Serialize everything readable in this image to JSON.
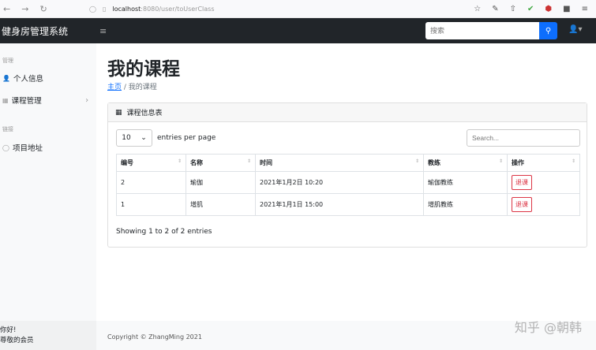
{
  "browser": {
    "url_host": "localhost",
    "url_path": ":8080/user/toUserClass"
  },
  "header": {
    "brand": "健身房管理系统",
    "search_placeholder": "搜索"
  },
  "sidebar": {
    "section1": "管理",
    "items": [
      {
        "label": "个人信息"
      },
      {
        "label": "课程管理"
      }
    ],
    "section2": "链接",
    "link": "项目地址",
    "greeting": "你好!",
    "role": "尊敬的会员"
  },
  "main": {
    "title": "我的课程",
    "breadcrumb_home": "主页",
    "breadcrumb_current": "我的课程",
    "card_title": "课程信息表",
    "page_size": "10",
    "entries_label": "entries per page",
    "search_placeholder": "Search...",
    "columns": [
      "编号",
      "名称",
      "时间",
      "教练",
      "操作"
    ],
    "rows": [
      {
        "id": "2",
        "name": "瑜伽",
        "time": "2021年1月2日 10:20",
        "coach": "瑜伽教练",
        "action": "退课"
      },
      {
        "id": "1",
        "name": "增肌",
        "time": "2021年1月1日 15:00",
        "coach": "增肌教练",
        "action": "退课"
      }
    ],
    "info": "Showing 1 to 2 of 2 entries"
  },
  "footer": {
    "copyright": "Copyright © ZhangMing 2021"
  },
  "watermark": "知乎 @朝韩"
}
